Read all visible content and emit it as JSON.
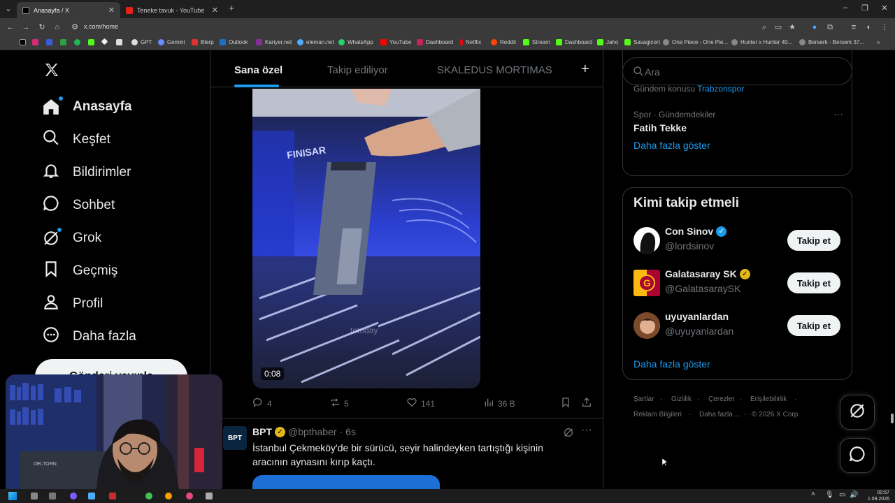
{
  "browser": {
    "tabs": [
      {
        "title": "Anasayfa / X",
        "active": true
      },
      {
        "title": "Teneke tavuk - YouTube",
        "active": false
      }
    ],
    "url": "x.com/home",
    "bookmarks": [
      "GPT",
      "Gemini",
      "Blerp",
      "Outlook",
      "Kariyer.net",
      "eleman.net",
      "WhatsApp",
      "YouTube",
      "Dashboard",
      "Netflix",
      "Reddit",
      "Stream",
      "Dashboard",
      "Jaho",
      "Savagicort",
      "One Piece - One Pie...",
      "Hunter x Hunter 40...",
      "Berserk - Berserk 37..."
    ]
  },
  "nav": {
    "items": [
      {
        "label": "Anasayfa",
        "icon": "home-icon"
      },
      {
        "label": "Keşfet",
        "icon": "search-icon"
      },
      {
        "label": "Bildirimler",
        "icon": "bell-icon"
      },
      {
        "label": "Sohbet",
        "icon": "chat-icon"
      },
      {
        "label": "Grok",
        "icon": "grok-icon"
      },
      {
        "label": "Geçmiş",
        "icon": "bookmark-icon"
      },
      {
        "label": "Profil",
        "icon": "person-icon"
      },
      {
        "label": "Daha fazla",
        "icon": "more-circle-icon"
      }
    ],
    "post_button": "Gönderi yayınla"
  },
  "feed": {
    "tabs": [
      "Sana özel",
      "Takip ediliyor",
      "SKALEDUS MORTIMAS"
    ],
    "video_time": "0:08",
    "watermark": "totoday",
    "video_label": "FINISAR",
    "actions": {
      "replies": "4",
      "reposts": "5",
      "likes": "141",
      "views": "36 B"
    },
    "next_post": {
      "name": "BPT",
      "handle": "@bpthaber",
      "time": "6s",
      "avatar_text": "BPT",
      "text_line1": "İstanbul Çekmeköy'de bir sürücü, seyir halindeyken tartıştığı kişinin",
      "text_line2": "aracının aynasını kırıp kaçtı."
    }
  },
  "right": {
    "search_placeholder": "Ara",
    "trends": {
      "partial_line": "Gündem konusu",
      "partial_link": "Trabzonspor",
      "category": "Spor · Gündemdekiler",
      "title": "Fatih Tekke",
      "show_more": "Daha fazla göster"
    },
    "who_to_follow": {
      "title": "Kimi takip etmeli",
      "users": [
        {
          "name": "Con Sinov",
          "handle": "@lordsinov",
          "button": "Takip et"
        },
        {
          "name": "Galatasaray SK",
          "handle": "@GalatasaraySK",
          "button": "Takip et"
        },
        {
          "name": "uyuyanlardan",
          "handle": "@uyuyanlardan",
          "button": "Takip et"
        }
      ],
      "show_more": "Daha fazla göster"
    },
    "footer": [
      "Şartlar",
      "Gizlilik",
      "Çerezler",
      "Erişilebilirlik",
      "Reklam Bilgileri",
      "Daha fazla ...",
      "© 2026 X Corp."
    ]
  },
  "webcam": {
    "shirt_text": "DELTORN"
  },
  "taskbar": {
    "time": "00:57",
    "date": "1.09.2026"
  },
  "colors": {
    "accent": "#1d9bf0",
    "gold": "#e2b719",
    "bg": "#000000"
  }
}
